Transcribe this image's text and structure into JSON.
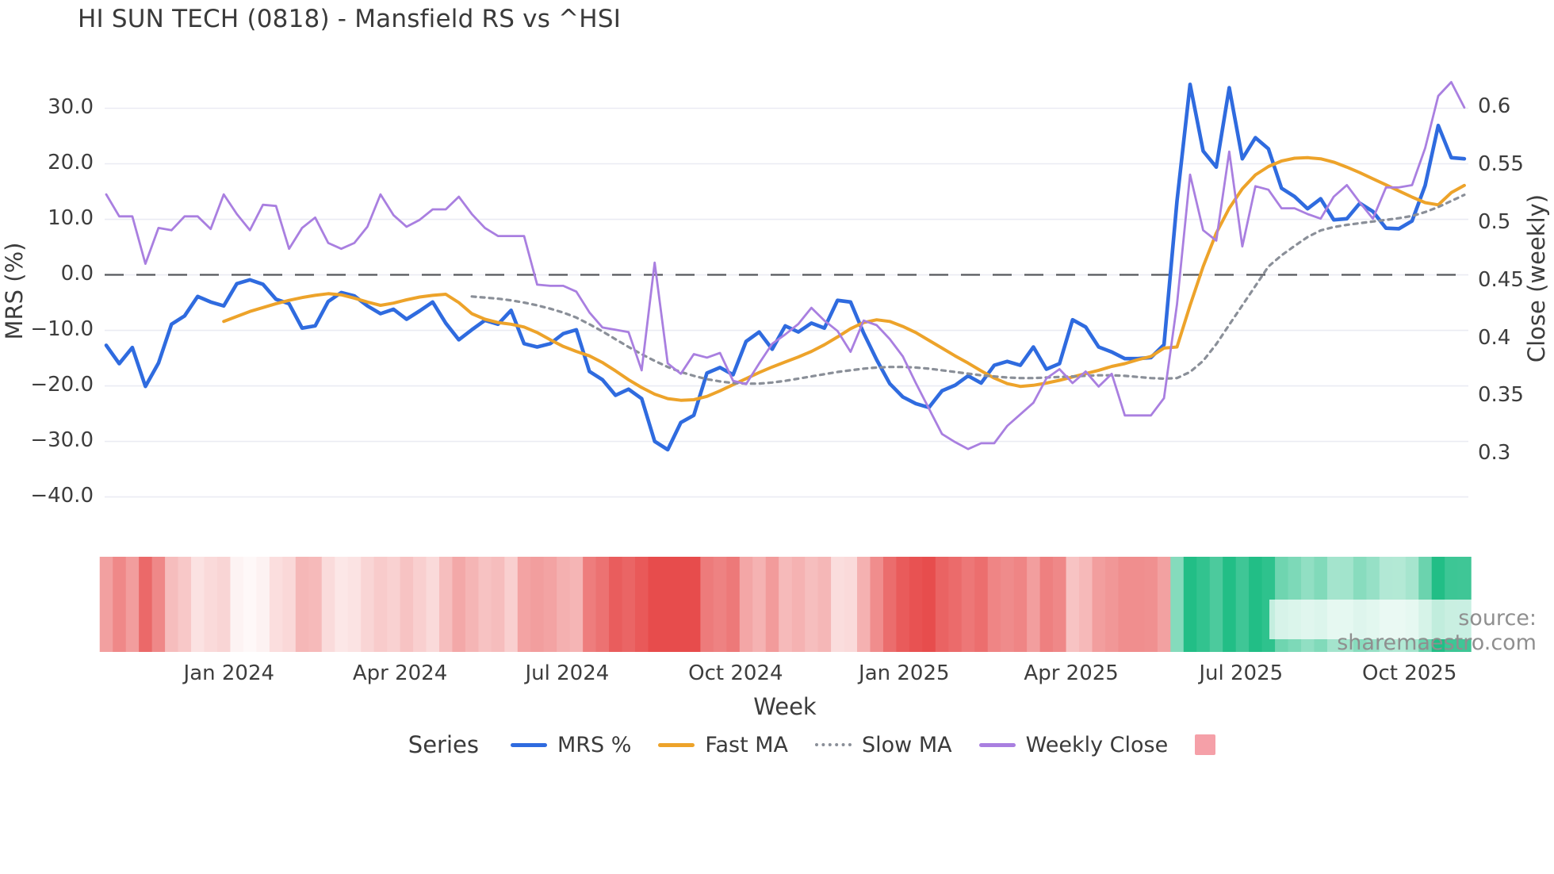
{
  "title": "HI SUN TECH (0818) - Mansfield RS vs ^HSI",
  "source_note": "source: sharemaestro.com",
  "legend": {
    "title": "Series",
    "items": [
      {
        "label": "MRS %",
        "color": "#2f6bdf",
        "style": "line"
      },
      {
        "label": "Fast MA",
        "color": "#eda32a",
        "style": "line"
      },
      {
        "label": "Slow MA",
        "color": "#8a8f98",
        "style": "dotted"
      },
      {
        "label": "Weekly Close",
        "color": "#a97fe0",
        "style": "line"
      },
      {
        "label": "",
        "color": "#f5a0a8",
        "style": "square"
      }
    ]
  },
  "chart_data": {
    "type": "line",
    "title": "HI SUN TECH (0818) - Mansfield RS vs ^HSI",
    "xlabel": "Week",
    "ylabel_left": "MRS (%)",
    "ylabel_right": "Close (weekly)",
    "x_unit": "weekly points, late Oct 2023 to early Nov 2025",
    "n_points": 105,
    "xlim": [
      -0.12,
      104.31
    ],
    "ylim_left": [
      -42.64,
      36.93
    ],
    "ylim_right": [
      0.251,
      0.6326
    ],
    "grid": "horizontal-left-axis",
    "zero_dashed_line": 0.0,
    "legend_position": "bottom",
    "x_ticks": [
      {
        "pos": 9.4,
        "label": "Jan 2024"
      },
      {
        "pos": 22.5,
        "label": "Apr 2024"
      },
      {
        "pos": 35.3,
        "label": "Jul 2024"
      },
      {
        "pos": 48.2,
        "label": "Oct 2024"
      },
      {
        "pos": 61.1,
        "label": "Jan 2025"
      },
      {
        "pos": 73.9,
        "label": "Apr 2025"
      },
      {
        "pos": 86.9,
        "label": "Jul 2025"
      },
      {
        "pos": 99.8,
        "label": "Oct 2025"
      }
    ],
    "left_ticks": [
      {
        "v": 30,
        "label": "30.0"
      },
      {
        "v": 20,
        "label": "20.0"
      },
      {
        "v": 10,
        "label": "10.0"
      },
      {
        "v": 0,
        "label": "0.0"
      },
      {
        "v": -10,
        "label": "−10.0"
      },
      {
        "v": -20,
        "label": "−20.0"
      },
      {
        "v": -30,
        "label": "−30.0"
      },
      {
        "v": -40,
        "label": "−40.0"
      }
    ],
    "right_ticks": [
      {
        "v": 0.6,
        "label": "0.6"
      },
      {
        "v": 0.55,
        "label": "0.55"
      },
      {
        "v": 0.5,
        "label": "0.5"
      },
      {
        "v": 0.45,
        "label": "0.45"
      },
      {
        "v": 0.4,
        "label": "0.4"
      },
      {
        "v": 0.35,
        "label": "0.35"
      },
      {
        "v": 0.3,
        "label": "0.3"
      }
    ],
    "series": [
      {
        "name": "MRS %",
        "axis": "left",
        "color": "#2f6bdf",
        "width": 4.6,
        "dash": "",
        "values": [
          -12.7,
          -16.0,
          -13.1,
          -20.1,
          -15.9,
          -8.9,
          -7.4,
          -3.9,
          -4.9,
          -5.6,
          -1.6,
          -0.9,
          -1.7,
          -4.4,
          -5.2,
          -9.6,
          -9.2,
          -4.8,
          -3.2,
          -3.8,
          -5.6,
          -7.0,
          -6.2,
          -8.0,
          -6.5,
          -4.9,
          -8.7,
          -11.7,
          -9.9,
          -8.2,
          -8.9,
          -6.4,
          -12.4,
          -13.0,
          -12.4,
          -10.6,
          -9.9,
          -17.4,
          -18.9,
          -21.7,
          -20.6,
          -22.3,
          -30.0,
          -31.5,
          -26.6,
          -25.3,
          -17.7,
          -16.7,
          -18.0,
          -12.0,
          -10.3,
          -13.4,
          -9.2,
          -10.3,
          -8.7,
          -9.6,
          -4.6,
          -4.9,
          -10.5,
          -15.3,
          -19.6,
          -22.0,
          -23.2,
          -23.9,
          -20.9,
          -19.9,
          -18.2,
          -19.5,
          -16.3,
          -15.6,
          -16.3,
          -13.0,
          -17.0,
          -16.0,
          -8.1,
          -9.4,
          -13.0,
          -13.9,
          -15.1,
          -15.1,
          -14.9,
          -12.6,
          13.3,
          34.3,
          22.3,
          19.4,
          33.7,
          20.9,
          24.7,
          22.7,
          15.6,
          14.1,
          11.9,
          13.7,
          9.9,
          10.1,
          12.9,
          11.4,
          8.4,
          8.3,
          9.7,
          16.1,
          26.9,
          21.1,
          20.9
        ]
      },
      {
        "name": "Fast MA",
        "axis": "left",
        "color": "#eda32a",
        "width": 4.0,
        "dash": "",
        "values": [
          null,
          null,
          null,
          null,
          null,
          null,
          null,
          null,
          null,
          -8.4,
          -7.5,
          -6.6,
          -5.9,
          -5.2,
          -4.6,
          -4.1,
          -3.7,
          -3.4,
          -3.6,
          -4.2,
          -4.9,
          -5.5,
          -5.1,
          -4.5,
          -4.0,
          -3.7,
          -3.5,
          -5.0,
          -7.0,
          -8.0,
          -8.6,
          -8.9,
          -9.4,
          -10.4,
          -11.7,
          -12.9,
          -13.8,
          -14.6,
          -15.8,
          -17.3,
          -18.9,
          -20.3,
          -21.5,
          -22.3,
          -22.6,
          -22.5,
          -21.9,
          -20.9,
          -19.8,
          -18.7,
          -17.6,
          -16.6,
          -15.7,
          -14.8,
          -13.8,
          -12.6,
          -11.2,
          -9.7,
          -8.6,
          -8.1,
          -8.4,
          -9.3,
          -10.4,
          -11.8,
          -13.2,
          -14.6,
          -15.9,
          -17.3,
          -18.6,
          -19.6,
          -20.1,
          -19.9,
          -19.5,
          -19.0,
          -18.4,
          -17.8,
          -17.2,
          -16.5,
          -16.0,
          -15.3,
          -14.7,
          -13.2,
          -13.0,
          -5.5,
          1.5,
          7.5,
          12.0,
          15.5,
          18.0,
          19.5,
          20.5,
          21.0,
          21.1,
          20.9,
          20.3,
          19.4,
          18.4,
          17.3,
          16.2,
          15.1,
          14.0,
          13.0,
          12.6,
          14.8,
          16.1
        ]
      },
      {
        "name": "Slow MA",
        "axis": "left",
        "color": "#8a8f98",
        "width": 3.2,
        "dash": "5 6",
        "values": [
          null,
          null,
          null,
          null,
          null,
          null,
          null,
          null,
          null,
          null,
          null,
          null,
          null,
          null,
          null,
          null,
          null,
          null,
          null,
          null,
          null,
          null,
          null,
          null,
          null,
          null,
          null,
          null,
          -3.9,
          -4.1,
          -4.3,
          -4.6,
          -5.0,
          -5.5,
          -6.1,
          -6.8,
          -7.7,
          -8.9,
          -10.2,
          -11.6,
          -13.0,
          -14.3,
          -15.5,
          -16.6,
          -17.5,
          -18.2,
          -18.8,
          -19.2,
          -19.5,
          -19.6,
          -19.6,
          -19.4,
          -19.1,
          -18.7,
          -18.3,
          -17.9,
          -17.5,
          -17.2,
          -16.9,
          -16.7,
          -16.6,
          -16.6,
          -16.7,
          -16.9,
          -17.2,
          -17.5,
          -17.8,
          -18.1,
          -18.3,
          -18.5,
          -18.6,
          -18.6,
          -18.5,
          -18.4,
          -18.3,
          -18.2,
          -18.1,
          -18.1,
          -18.2,
          -18.4,
          -18.6,
          -18.7,
          -18.6,
          -17.5,
          -15.5,
          -12.5,
          -9.0,
          -5.5,
          -2.0,
          1.5,
          3.5,
          5.2,
          6.8,
          8.0,
          8.6,
          9.0,
          9.3,
          9.6,
          9.9,
          10.2,
          10.6,
          11.3,
          12.2,
          13.3,
          14.4
        ]
      },
      {
        "name": "Weekly Close",
        "axis": "right",
        "color": "#a97fe0",
        "width": 2.8,
        "dash": "",
        "values": [
          0.525,
          0.506,
          0.506,
          0.465,
          0.496,
          0.494,
          0.506,
          0.506,
          0.495,
          0.525,
          0.508,
          0.494,
          0.516,
          0.515,
          0.478,
          0.496,
          0.505,
          0.483,
          0.478,
          0.483,
          0.497,
          0.525,
          0.507,
          0.497,
          0.503,
          0.512,
          0.512,
          0.523,
          0.508,
          0.496,
          0.489,
          0.489,
          0.489,
          0.447,
          0.446,
          0.446,
          0.441,
          0.423,
          0.41,
          0.408,
          0.406,
          0.373,
          0.466,
          0.379,
          0.37,
          0.387,
          0.384,
          0.388,
          0.364,
          0.361,
          0.379,
          0.396,
          0.404,
          0.413,
          0.427,
          0.416,
          0.407,
          0.389,
          0.416,
          0.412,
          0.4,
          0.385,
          0.362,
          0.34,
          0.318,
          0.311,
          0.305,
          0.31,
          0.31,
          0.325,
          0.335,
          0.345,
          0.366,
          0.374,
          0.362,
          0.372,
          0.359,
          0.37,
          0.334,
          0.334,
          0.334,
          0.349,
          0.43,
          0.542,
          0.494,
          0.485,
          0.562,
          0.48,
          0.532,
          0.529,
          0.513,
          0.513,
          0.508,
          0.504,
          0.523,
          0.533,
          0.518,
          0.504,
          0.531,
          0.531,
          0.533,
          0.565,
          0.61,
          0.622,
          0.6
        ]
      }
    ],
    "heatmap_strip": {
      "basis": "MRS % sign and magnitude per week",
      "negative_color": "#e74c4c",
      "positive_color": "#22be86",
      "intensity_divisor": 24
    }
  }
}
